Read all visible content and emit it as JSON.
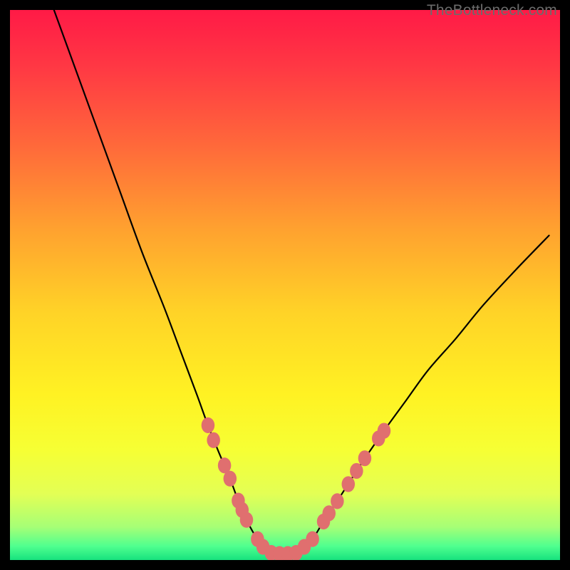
{
  "watermark": "TheBottleneck.com",
  "accent_dot_color": "#e06f6f",
  "curve_color": "#000000",
  "gradient_stops": [
    {
      "offset": 0.0,
      "color": "#ff1a46"
    },
    {
      "offset": 0.1,
      "color": "#ff3744"
    },
    {
      "offset": 0.25,
      "color": "#ff6a3a"
    },
    {
      "offset": 0.4,
      "color": "#ffa22f"
    },
    {
      "offset": 0.55,
      "color": "#ffd327"
    },
    {
      "offset": 0.7,
      "color": "#fff223"
    },
    {
      "offset": 0.8,
      "color": "#f6ff34"
    },
    {
      "offset": 0.88,
      "color": "#e3ff55"
    },
    {
      "offset": 0.94,
      "color": "#a6ff76"
    },
    {
      "offset": 0.975,
      "color": "#4fff8f"
    },
    {
      "offset": 1.0,
      "color": "#17e27e"
    }
  ],
  "chart_data": {
    "type": "line",
    "title": "",
    "xlabel": "",
    "ylabel": "",
    "xlim": [
      0,
      100
    ],
    "ylim": [
      0,
      100
    ],
    "grid": false,
    "legend": false,
    "series": [
      {
        "name": "curve",
        "x": [
          8,
          12,
          16,
          20,
          24,
          28,
          31,
          34,
          36,
          38,
          40,
          41.5,
          43,
          45,
          47,
          49,
          51,
          53,
          55,
          57,
          60,
          64,
          68,
          72,
          76,
          81,
          86,
          92,
          98
        ],
        "y": [
          100,
          89,
          78,
          67,
          56,
          46,
          38,
          30,
          24.5,
          19.5,
          14.8,
          10.8,
          7.3,
          3.8,
          1.8,
          1.1,
          1.1,
          1.8,
          3.8,
          7.0,
          11.5,
          17.7,
          23.5,
          29.0,
          34.5,
          40.2,
          46.3,
          52.8,
          59.0
        ]
      }
    ],
    "markers": [
      {
        "x": 36.0,
        "y": 24.5
      },
      {
        "x": 37.0,
        "y": 21.8
      },
      {
        "x": 39.0,
        "y": 17.2
      },
      {
        "x": 40.0,
        "y": 14.8
      },
      {
        "x": 41.5,
        "y": 10.8
      },
      {
        "x": 42.2,
        "y": 9.1
      },
      {
        "x": 43.0,
        "y": 7.3
      },
      {
        "x": 45.0,
        "y": 3.8
      },
      {
        "x": 46.0,
        "y": 2.4
      },
      {
        "x": 47.5,
        "y": 1.3
      },
      {
        "x": 49.0,
        "y": 1.1
      },
      {
        "x": 50.5,
        "y": 1.1
      },
      {
        "x": 52.0,
        "y": 1.3
      },
      {
        "x": 53.5,
        "y": 2.4
      },
      {
        "x": 55.0,
        "y": 3.8
      },
      {
        "x": 57.0,
        "y": 7.0
      },
      {
        "x": 58.0,
        "y": 8.5
      },
      {
        "x": 59.5,
        "y": 10.7
      },
      {
        "x": 61.5,
        "y": 13.8
      },
      {
        "x": 63.0,
        "y": 16.2
      },
      {
        "x": 64.5,
        "y": 18.5
      },
      {
        "x": 67.0,
        "y": 22.1
      },
      {
        "x": 68.0,
        "y": 23.5
      }
    ],
    "marker_radius": 1.2
  }
}
